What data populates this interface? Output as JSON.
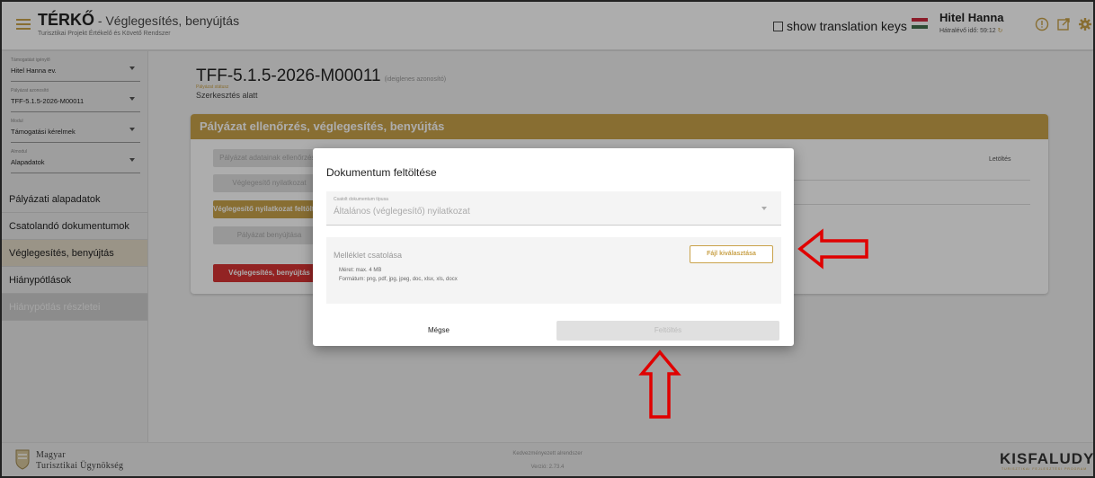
{
  "header": {
    "title": "TÉRKŐ",
    "title_suffix": " - Véglegesítés, benyújtás",
    "subtitle": "Turisztikai Projekt Értékelő és Követő Rendszer",
    "translation_toggle": "show translation keys",
    "user_name": "Hitel Hanna",
    "time_left": "Hátralévő idő: 59:12",
    "refresh_glyph": "↻",
    "icons": [
      "info-icon",
      "external-link-icon",
      "settings-gear-icon"
    ]
  },
  "sidebar": {
    "selects": [
      {
        "label": "Támogatást igénylő",
        "value": "Hitel Hanna ev."
      },
      {
        "label": "Pályázat azonosító",
        "value": "TFF-5.1.5-2026-M00011"
      },
      {
        "label": "Modul",
        "value": "Támogatási kérelmek"
      },
      {
        "label": "Almodul",
        "value": "Alapadatok"
      }
    ],
    "nav": [
      {
        "label": "Pályázati alapadatok"
      },
      {
        "label": "Csatolandó dokumentumok"
      },
      {
        "label": "Véglegesítés, benyújtás"
      },
      {
        "label": "Hiánypótlások"
      },
      {
        "label": "Hiánypótlás részletei"
      }
    ]
  },
  "main": {
    "project_id": "TFF-5.1.5-2026-M00011",
    "temp_note": "(ideiglenes azonosító)",
    "status_label": "Pályázat státusz",
    "status": "Szerkesztés alatt",
    "card_title": "Pályázat ellenőrzés, véglegesítés, benyújtás",
    "buttons": [
      "Pályázat adatainak ellenőrzése",
      "Véglegesítő nyilatkozat",
      "Véglegesítő nyilatkozat feltöltése",
      "Pályázat benyújtása",
      "Véglegesítés, benyújtás"
    ],
    "download_col": "Letöltés"
  },
  "dialog": {
    "title": "Dokumentum feltöltése",
    "doc_type_label": "Csatolt dokumentum típusa",
    "doc_type_value": "Általános (véglegesítő) nyilatkozat",
    "attach_title": "Melléklet csatolása",
    "size_note": "Méret: max. 4 MB",
    "formats_note": "Formátum: png, pdf, jpg, jpeg, doc, xlsx, xls, docx",
    "file_button": "Fájl kiválasztása",
    "cancel_button": "Mégse",
    "upload_button": "Feltöltés"
  },
  "footer": {
    "org_line1": "Magyar",
    "org_line2": "Turisztikai Ügynökség",
    "center1": "Kedvezményezett alrendszer",
    "center2": "Verzió: 2.73.4",
    "brand": "KISFALUDY",
    "brand_sub": "TURISZTIKAI FEJLESZTÉSI PROGRAM"
  },
  "colors": {
    "accent": "#c9a24a",
    "danger": "#d83434",
    "annotation": "#e00000"
  }
}
